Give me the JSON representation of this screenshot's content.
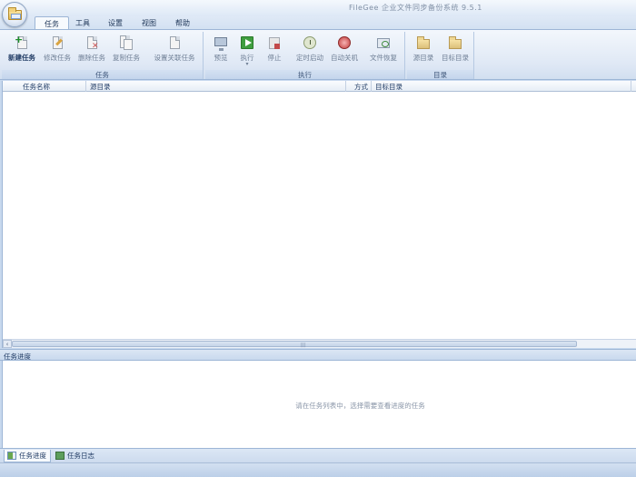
{
  "window": {
    "title": "FileGee 企业文件同步备份系统 9.5.1"
  },
  "menu_tabs": [
    "任务",
    "工具",
    "设置",
    "视图",
    "帮助"
  ],
  "ribbon": {
    "groups": {
      "task": "任务",
      "execute": "执行",
      "directory": "目录"
    },
    "buttons": {
      "new_task": "新建任务",
      "modify_task": "修改任务",
      "delete_task": "删除任务",
      "copy_task": "复制任务",
      "related_tasks": "设置关联任务",
      "preview": "预览",
      "run": "执行",
      "stop": "停止",
      "timed_start": "定时启动",
      "auto_shutdown": "自动关机",
      "file_restore": "文件恢复",
      "source_dir": "源目录",
      "target_dir": "目标目录"
    },
    "run_dropdown_arrow": "▾"
  },
  "task_table": {
    "columns": [
      "任务名称",
      "源目录",
      "方式",
      "目标目录"
    ],
    "rows": []
  },
  "progress_panel": {
    "title": "任务进度",
    "hint": "请在任务列表中，选择需要查看进度的任务"
  },
  "bottom_tabs": {
    "progress": "任务进度",
    "log": "任务日志"
  },
  "scrollbar": {
    "left_arrow": "‹",
    "right_arrow": "›",
    "grip": "|||"
  }
}
